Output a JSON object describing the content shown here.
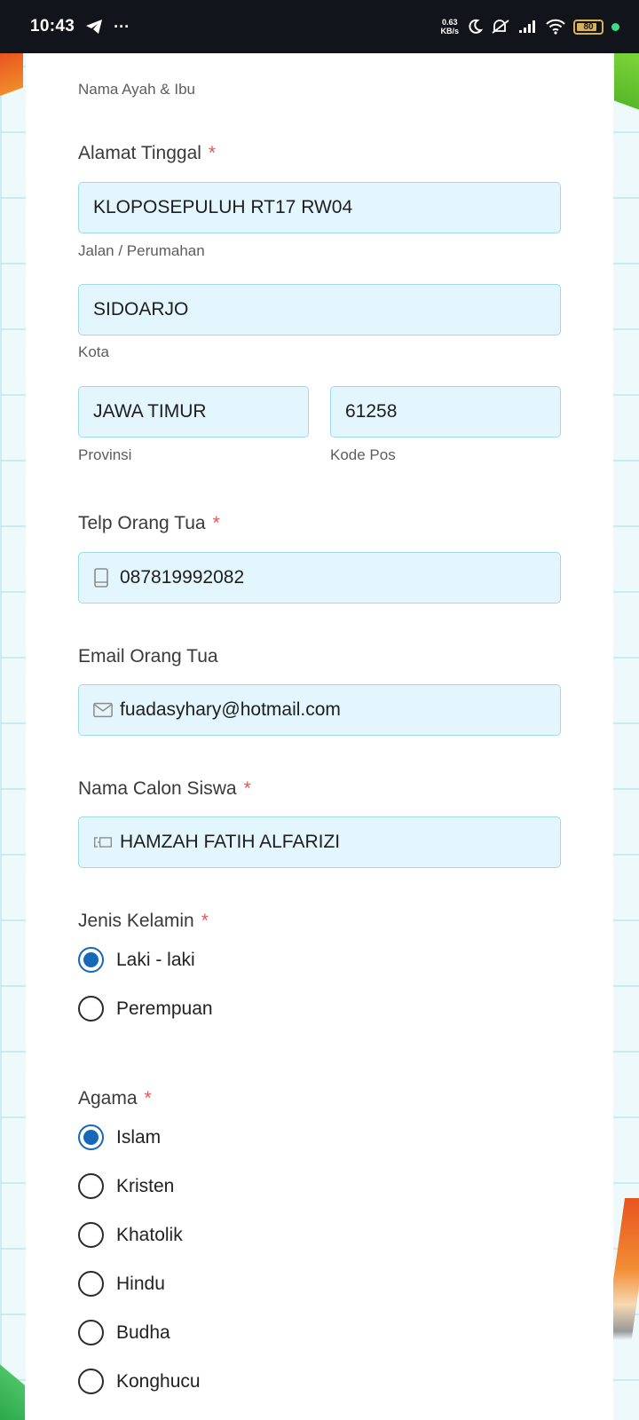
{
  "status_bar": {
    "time": "10:43",
    "more": "···",
    "speed_value": "0.63",
    "speed_unit": "KB/s",
    "battery": "80"
  },
  "form": {
    "parent_name_hint": "Nama Ayah & Ibu",
    "address": {
      "label": "Alamat Tinggal",
      "required_mark": "*",
      "street_value": "KLOPOSEPULUH RT17 RW04",
      "street_hint": "Jalan / Perumahan",
      "city_value": "SIDOARJO",
      "city_hint": "Kota",
      "province_value": "JAWA TIMUR",
      "province_hint": "Provinsi",
      "postal_value": "61258",
      "postal_hint": "Kode Pos"
    },
    "phone": {
      "label": "Telp Orang Tua",
      "required_mark": "*",
      "value": "087819992082",
      "icon": "phone-icon"
    },
    "email": {
      "label": "Email Orang Tua",
      "value": "fuadasyhary@hotmail.com",
      "icon": "envelope-icon"
    },
    "student_name": {
      "label": "Nama Calon Siswa",
      "required_mark": "*",
      "value": "HAMZAH FATIH ALFARIZI",
      "icon": "id-card-icon"
    },
    "gender": {
      "label": "Jenis Kelamin",
      "required_mark": "*",
      "options": [
        "Laki - laki",
        "Perempuan"
      ],
      "selected": "Laki - laki"
    },
    "religion": {
      "label": "Agama",
      "required_mark": "*",
      "options": [
        "Islam",
        "Kristen",
        "Khatolik",
        "Hindu",
        "Budha",
        "Konghucu"
      ],
      "selected": "Islam"
    }
  },
  "colors": {
    "accent": "#1668b8",
    "field_bg": "#e4f6fd",
    "field_border": "#9fd9ee",
    "required": "#e05757"
  }
}
